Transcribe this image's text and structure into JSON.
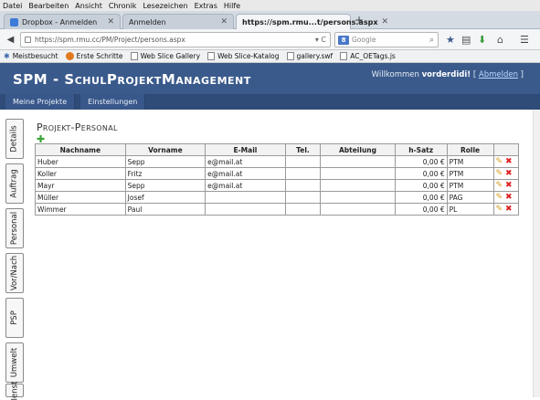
{
  "menu": [
    "Datei",
    "Bearbeiten",
    "Ansicht",
    "Chronik",
    "Lesezeichen",
    "Extras",
    "Hilfe"
  ],
  "tabs": [
    {
      "label": "Dropbox - Anmelden",
      "active": false
    },
    {
      "label": "Anmelden",
      "active": false
    },
    {
      "label": "https://spm.rmu...t/persons.aspx",
      "active": true
    }
  ],
  "url": "https://spm.rmu.cc/PM/Project/persons.aspx",
  "search_placeholder": "Google",
  "bookmarks": [
    "Meistbesucht",
    "Erste Schritte",
    "Web Slice Gallery",
    "Web Slice-Katalog",
    "gallery.swf",
    "AC_OETags.js"
  ],
  "app": {
    "title": "SPM - SchulProjektManagement",
    "welcome_prefix": "Willkommen",
    "user": "vorderdidi!",
    "logout": "Abmelden"
  },
  "appnav": [
    "Meine Projekte",
    "Einstellungen"
  ],
  "vtabs": [
    "Details",
    "Auftrag",
    "Personal",
    "Vor/Nach",
    "PSP",
    "Umwelt",
    "Ienst"
  ],
  "page_title": "Projekt-Personal",
  "table": {
    "headers": [
      "Nachname",
      "Vorname",
      "E-Mail",
      "Tel.",
      "Abteilung",
      "h-Satz",
      "Rolle",
      ""
    ],
    "rows": [
      [
        "Huber",
        "Sepp",
        "e@mail.at",
        "",
        "",
        "0,00 €",
        "PTM"
      ],
      [
        "Koller",
        "Fritz",
        "e@mail.at",
        "",
        "",
        "0,00 €",
        "PTM"
      ],
      [
        "Mayr",
        "Sepp",
        "e@mail.at",
        "",
        "",
        "0,00 €",
        "PTM"
      ],
      [
        "Müller",
        "Josef",
        "",
        "",
        "",
        "0,00 €",
        "PAG"
      ],
      [
        "Wimmer",
        "Paul",
        "",
        "",
        "",
        "0,00 €",
        "PL"
      ]
    ]
  }
}
